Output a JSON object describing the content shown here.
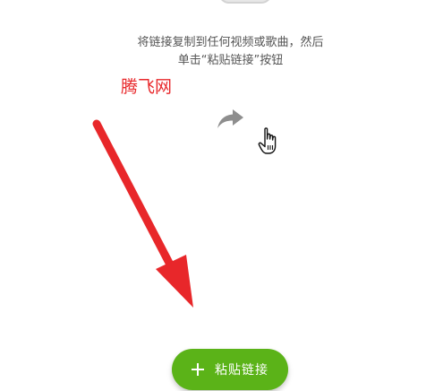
{
  "instruction": {
    "line1": "将链接复制到任何视频或歌曲，然后",
    "line2": "单击“粘贴链接”按钮"
  },
  "watermark": {
    "text": "腾飞网"
  },
  "icons": {
    "share": "share-arrow-icon",
    "cursor": "hand-pointer-icon",
    "plus": "plus-icon"
  },
  "paste_button": {
    "label": "粘贴链接"
  },
  "colors": {
    "accent": "#5bb318",
    "annotation": "#e8272a",
    "text": "#555555",
    "icon": "#8e8e8e"
  }
}
